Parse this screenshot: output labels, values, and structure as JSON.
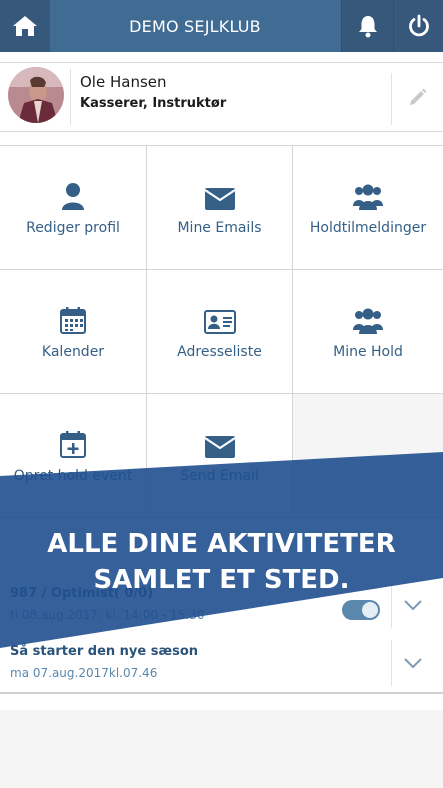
{
  "header": {
    "title": "DEMO SEJLKLUB",
    "icons": [
      "home-icon",
      "bell-icon",
      "power-icon"
    ],
    "color": "#406b93"
  },
  "profile": {
    "name": "Ole Hansen",
    "role": "Kasserer, Instruktør",
    "edit_icon": "pencil-icon"
  },
  "menu": [
    {
      "label": "Rediger profil",
      "icon": "user-icon"
    },
    {
      "label": "Mine Emails",
      "icon": "envelope-icon"
    },
    {
      "label": "Holdtilmeldinger",
      "icon": "group-icon"
    },
    {
      "label": "Kalender",
      "icon": "calendar-icon"
    },
    {
      "label": "Adresseliste",
      "icon": "address-card-icon"
    },
    {
      "label": "Mine Hold",
      "icon": "group-icon"
    },
    {
      "label": "Opret hold event",
      "icon": "calendar-plus-icon"
    },
    {
      "label": "Send Email",
      "icon": "envelope-icon"
    }
  ],
  "activities": [
    {
      "title": "987 / Optimist( 0/0)",
      "subtitle": "ti 08.aug.2017, kl. 14:00 - 15:30",
      "toggle_on": true
    },
    {
      "title": "Så starter den nye sæson",
      "subtitle": "ma 07.aug.2017kl.07.46"
    }
  ],
  "banner": {
    "line1": "ALLE DINE AKTIVITETER",
    "line2": "SAMLET ET STED.",
    "color": "#1f4f8f"
  }
}
